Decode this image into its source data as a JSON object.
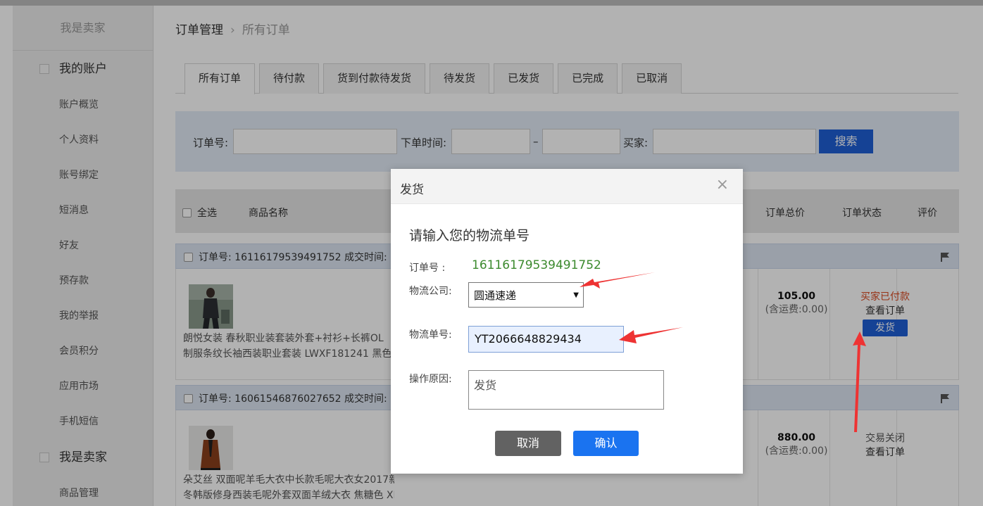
{
  "sidebar": {
    "title": "我是卖家",
    "account_group": "我的账户",
    "account_items": [
      "账户概览",
      "个人资料",
      "账号绑定",
      "短消息",
      "好友",
      "预存款",
      "我的举报",
      "会员积分",
      "应用市场",
      "手机短信"
    ],
    "seller_group": "我是卖家",
    "seller_items": [
      "商品管理"
    ]
  },
  "breadcrumb": {
    "root": "订单管理",
    "separator": "›",
    "current": "所有订单"
  },
  "tabs": [
    "所有订单",
    "待付款",
    "货到付款待发货",
    "待发货",
    "已发货",
    "已完成",
    "已取消"
  ],
  "search": {
    "order_no_label": "订单号:",
    "time_label": "下单时间:",
    "dash": "–",
    "buyer_label": "买家:",
    "button": "搜索"
  },
  "table_header": {
    "select_all": "全选",
    "product": "商品名称",
    "total": "订单总价",
    "status": "订单状态",
    "review": "评价"
  },
  "orders": [
    {
      "head": "订单号:   16116179539491752 成交时间:",
      "name_line1": "朗悦女装 春秋职业装套装外套+衬衫+长裤OL",
      "name_line2": "制服条纹长袖西装职业套装 LWXF181241 黑色",
      "price": "105.00",
      "shipping": "(含运费:0.00)",
      "status": "买家已付款",
      "view": "查看订单",
      "action": "发货"
    },
    {
      "head": "订单号:   16061546876027652 成交时间:",
      "name_line1": "朵艾丝 双面呢羊毛大衣中长款毛呢大衣女2017新款 秋",
      "name_line2": "冬韩版修身西装毛呢外套双面羊绒大衣 焦糖色 XL",
      "price": "880.00",
      "shipping": "(含运费:0.00)",
      "status": "交易关闭",
      "view": "查看订单"
    }
  ],
  "modal": {
    "title": "发货",
    "close": "×",
    "heading": "请输入您的物流单号",
    "order_label": "订单号   :",
    "order_value": "16116179539491752",
    "company_label": "物流公司:",
    "company_value": "圆通速递",
    "tracking_label": "物流单号:",
    "tracking_value": "YT2066648829434",
    "reason_label": "操作原因:",
    "reason_value": "发货",
    "cancel": "取消",
    "confirm": "确认"
  },
  "colors": {
    "primary": "#1f5fd6",
    "confirm": "#1a73f0",
    "paid": "#d9481f",
    "order_no": "#3c8a2e",
    "arrow": "#ee3333"
  }
}
